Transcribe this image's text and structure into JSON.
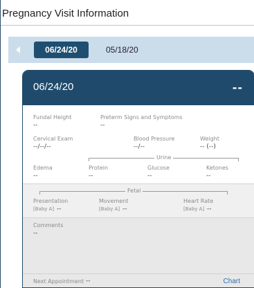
{
  "title": "Pregnancy Visit Information",
  "dates": {
    "selected": "06/24/20",
    "other": "05/18/20"
  },
  "card": {
    "date": "06/24/20",
    "status": "--",
    "fundal_height": {
      "label": "Fundal Height",
      "value": "--"
    },
    "preterm": {
      "label": "Preterm Signs and Symptoms",
      "value": "--"
    },
    "cervical_exam": {
      "label": "Cervical Exam",
      "value": "--/--/--"
    },
    "blood_pressure": {
      "label": "Blood Pressure",
      "value": "--/--"
    },
    "weight": {
      "label": "Weight",
      "value": "-- (--)"
    },
    "urine_group": "Urine",
    "edema": {
      "label": "Edema",
      "value": "--"
    },
    "protein": {
      "label": "Protein",
      "value": "--"
    },
    "glucose": {
      "label": "Glucose",
      "value": "--"
    },
    "ketones": {
      "label": "Ketones",
      "value": "--"
    },
    "fetal_group": "Fetal",
    "presentation": {
      "label": "Presentation",
      "baby": "[Baby A]",
      "value": "--"
    },
    "movement": {
      "label": "Movement",
      "baby": "[Baby A]",
      "value": "--"
    },
    "heart_rate": {
      "label": "Heart Rate",
      "baby": "[Baby A]",
      "value": "--"
    },
    "comments": {
      "label": "Comments",
      "value": "--"
    },
    "next_appointment": {
      "label": "Next Appointment",
      "value": "--"
    },
    "chart_link": "Chart"
  }
}
